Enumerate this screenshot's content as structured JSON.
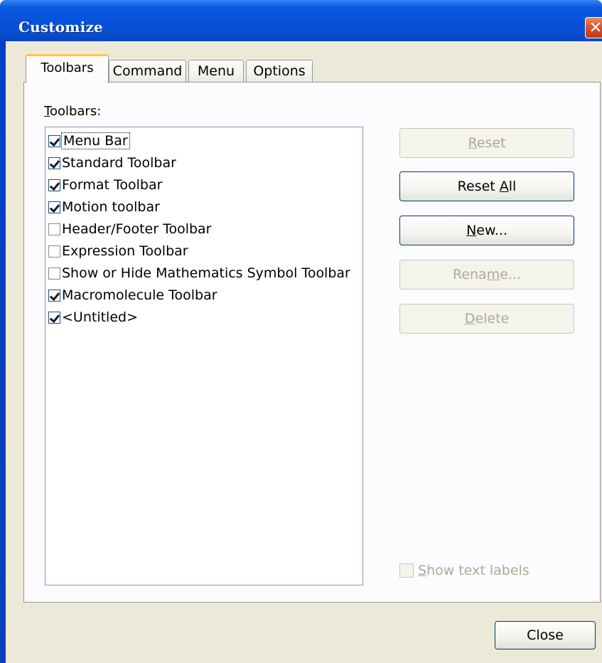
{
  "window": {
    "title": "Customize"
  },
  "tabs": [
    {
      "label": "Toolbars"
    },
    {
      "label": "Command"
    },
    {
      "label": "Menu"
    },
    {
      "label": "Options"
    }
  ],
  "panel": {
    "list_label_accel": "T",
    "list_label_rest": "oolbars:",
    "toolbars": [
      {
        "label": "Menu Bar",
        "checked": true
      },
      {
        "label": "Standard Toolbar",
        "checked": true
      },
      {
        "label": "Format Toolbar",
        "checked": true
      },
      {
        "label": "Motion toolbar",
        "checked": true
      },
      {
        "label": "Header/Footer Toolbar",
        "checked": false
      },
      {
        "label": "Expression Toolbar",
        "checked": false
      },
      {
        "label": "Show or Hide Mathematics Symbol Toolbar",
        "checked": false
      },
      {
        "label": "Macromolecule Toolbar",
        "checked": true
      },
      {
        "label": "<Untitled>",
        "checked": true
      }
    ],
    "buttons": {
      "reset": {
        "pre": "",
        "accel": "R",
        "post": "eset",
        "enabled": false
      },
      "reset_all": {
        "pre": "Reset ",
        "accel": "A",
        "post": "ll",
        "enabled": true
      },
      "new": {
        "pre": "",
        "accel": "N",
        "post": "ew...",
        "enabled": true
      },
      "rename": {
        "pre": "Rena",
        "accel": "m",
        "post": "e...",
        "enabled": false
      },
      "delete": {
        "pre": "",
        "accel": "D",
        "post": "elete",
        "enabled": false
      }
    },
    "show_text_labels": {
      "accel": "S",
      "rest": "how text labels",
      "checked": false,
      "enabled": false
    }
  },
  "footer": {
    "close_label": "Close"
  },
  "colors": {
    "titlebar": "#0a5ae0",
    "dialog_bg": "#ece9d8",
    "tab_highlight": "#ffc83c",
    "close_x": "#d9502c"
  }
}
